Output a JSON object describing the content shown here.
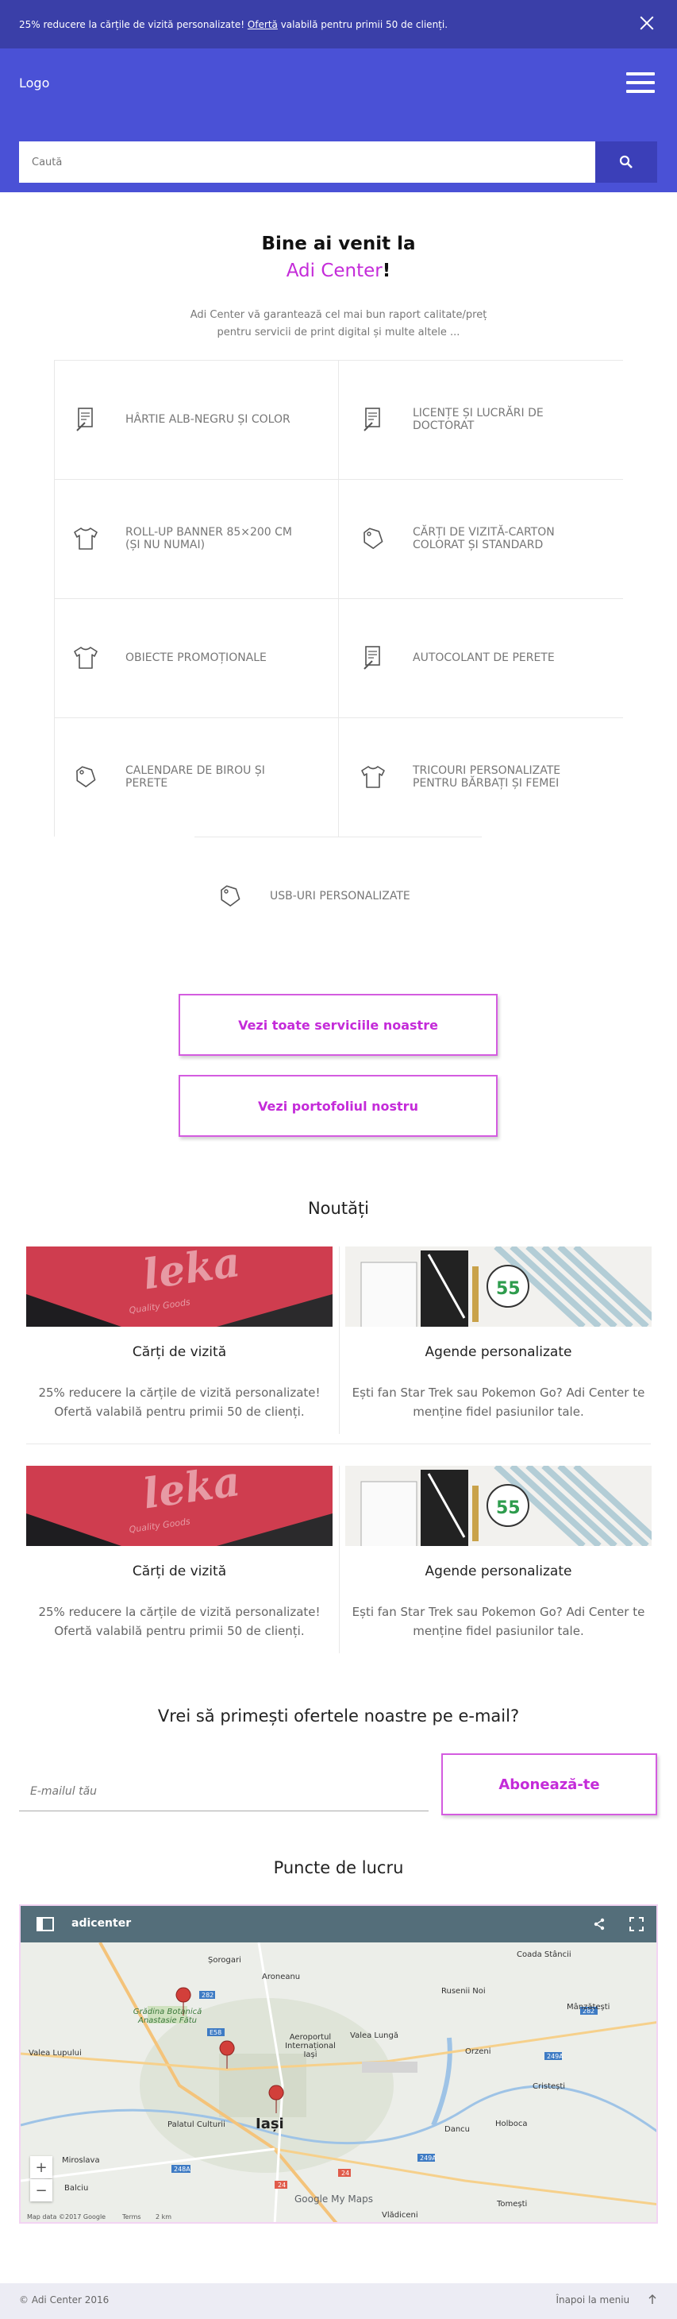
{
  "promo": {
    "text_before": "25% reducere la cărțile de vizită personalizate! ",
    "link": "Ofertă",
    "text_after": " valabilă pentru primii 50 de clienți.",
    "close_icon": "close-icon"
  },
  "header": {
    "logo": "Logo",
    "menu_icon": "hamburger-menu-icon",
    "search_placeholder": "Caută",
    "search_icon": "search-icon"
  },
  "welcome": {
    "line1": "Bine ai venit la",
    "brand": "Adi Center",
    "exclaim": "!",
    "desc1": "Adi Center vă garantează cel mai bun raport calitate/preț",
    "desc2": "pentru servicii de print digital și multe altele ..."
  },
  "services": [
    {
      "label": "Hârtie alb-negru și color",
      "icon": "document-pen-icon"
    },
    {
      "label": "Licențe și lucrări de doctorat",
      "icon": "document-pen-icon"
    },
    {
      "label": "Roll-up banner 85×200 cm (și nu numai)",
      "icon": "tshirt-icon"
    },
    {
      "label": "Cărți de vizită-carton colorat și standard",
      "icon": "tag-icon"
    },
    {
      "label": "Obiecte promoționale",
      "icon": "tshirt-icon"
    },
    {
      "label": "Autocolant de perete",
      "icon": "document-pen-icon"
    },
    {
      "label": "Calendare de birou și perete",
      "icon": "tag-icon"
    },
    {
      "label": "Tricouri personalizate pentru bărbați și femei",
      "icon": "tshirt-icon"
    },
    {
      "label": "USB-uri personalizate",
      "icon": "tag-icon"
    }
  ],
  "buttons": {
    "all_services": "Vezi toate serviciile noastre",
    "portfolio": "Vezi portofoliul nostru"
  },
  "news": {
    "title": "Noutăți",
    "items": [
      {
        "title": "Cărți de vizită",
        "text1": "25% reducere la cărțile de vizită personalizate!",
        "text2": "Ofertă valabilă pentru primii 50 de clienți."
      },
      {
        "title": "Agende personalizate",
        "text1": "Ești fan Star Trek sau Pokemon Go? Adi Center te",
        "text2": "menține fidel pasiunilor tale."
      },
      {
        "title": "Cărți de vizită",
        "text1": "25% reducere la cărțile de vizită personalizate!",
        "text2": "Ofertă valabilă pentru primii 50 de clienți."
      },
      {
        "title": "Agende personalizate",
        "text1": "Ești fan Star Trek sau Pokemon Go? Adi Center te",
        "text2": "menține fidel pasiunilor tale."
      }
    ]
  },
  "newsletter": {
    "title": "Vrei să primești ofertele noastre pe e-mail?",
    "placeholder": "E-mailul tău",
    "button": "Abonează-te"
  },
  "map": {
    "title": "Puncte de lucru",
    "bar_title": "adicenter",
    "places": [
      "Șorogari",
      "Aroneanu",
      "Rusenii Noi",
      "Coada Stâncii",
      "Grădina Botanică Anastasie Fătu",
      "Valea Lupului",
      "Aeroportul Internațional Iași",
      "Valea Lungă",
      "Mânzătești",
      "Orzeni",
      "Cristești",
      "Palatul Culturii",
      "Iași",
      "Dancu",
      "Holboca",
      "Miroslava",
      "Tomești",
      "Balciu",
      "Vlădiceni"
    ],
    "zoom_in": "+",
    "zoom_out": "−",
    "attribution": "Map data ©2017 Google",
    "terms": "Terms",
    "scale": "2 km",
    "brand": "Google My Maps"
  },
  "footer": {
    "copyright": "©   Adi Center 2016",
    "back": "Înapoi la meniu",
    "back_icon": "arrow-up-icon"
  },
  "colors": {
    "promo_bg": "#3a3fa8",
    "header_bg": "#4a51d6",
    "accent": "#c42bd9",
    "search_btn": "#3b3fb8"
  }
}
